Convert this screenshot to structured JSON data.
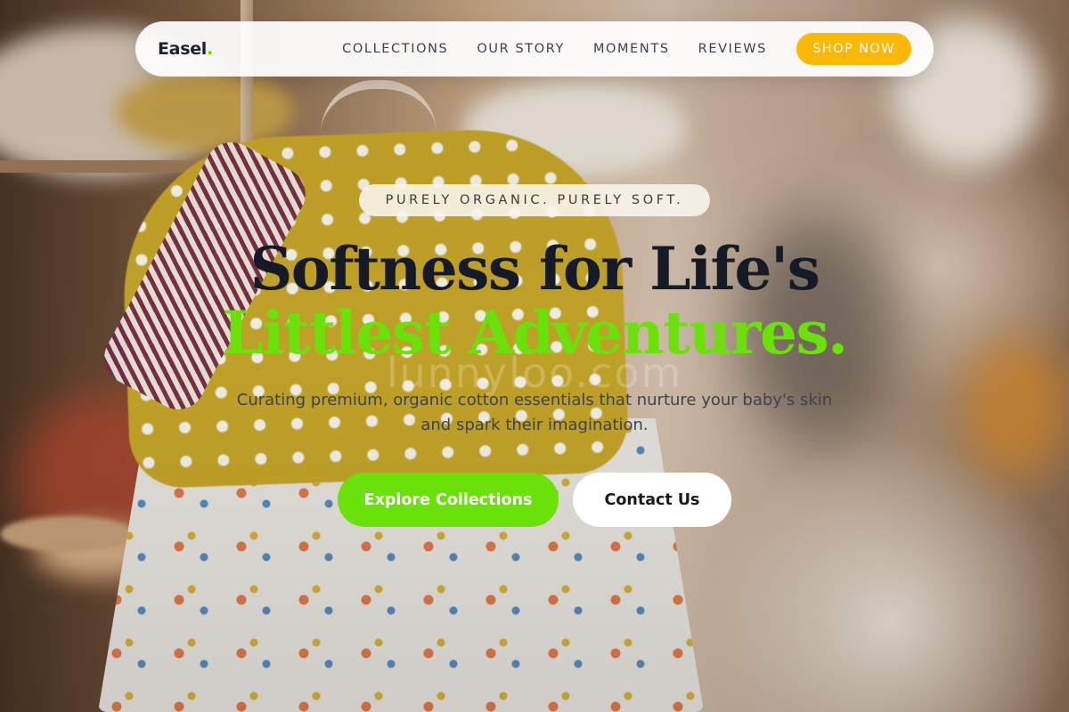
{
  "nav": {
    "logo_text": "Easel",
    "logo_dot": ".",
    "links": [
      "COLLECTIONS",
      "OUR STORY",
      "MOMENTS",
      "REVIEWS"
    ],
    "cta_label": "SHOP NOW"
  },
  "hero": {
    "badge": "PURELY ORGANIC. PURELY SOFT.",
    "headline_line1": "Softness for Life's",
    "headline_line2": "Littlest Adventures.",
    "subtitle": "Curating premium, organic cotton essentials that nurture your baby's skin and spark their imagination.",
    "primary_button": "Explore Collections",
    "secondary_button": "Contact Us",
    "watermark": "lunnyloo.com"
  },
  "colors": {
    "accent_green": "#6be10a",
    "cta_yellow": "#fbb806",
    "headline_dark": "#161a27"
  },
  "background": {
    "image_subject": "blurred boutique shelf with hanging yellow polka-dot and printed baby dresses"
  }
}
